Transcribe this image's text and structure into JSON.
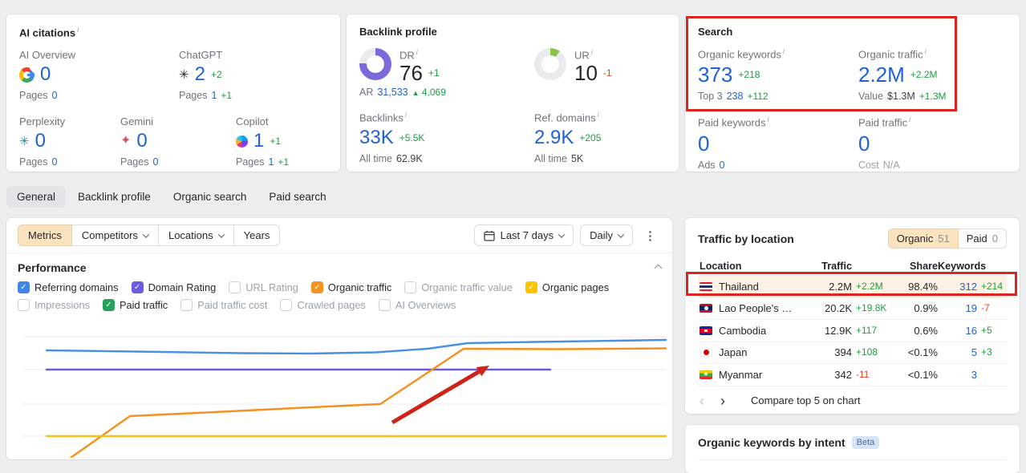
{
  "icons": {
    "info": "i",
    "check": "✓",
    "kebab": "⋮",
    "chevron_left": "‹",
    "chevron_right": "›",
    "up_triangle": "▲",
    "chatgpt_glyph": "✳",
    "perplexity_glyph": "✳",
    "gemini_glyph": "✦"
  },
  "ai_citations": {
    "title": "AI citations",
    "pages_label": "Pages",
    "items": [
      {
        "label": "AI Overview",
        "icon": "google-icon",
        "value": "0",
        "delta": "",
        "pages": "0",
        "pages_delta": ""
      },
      {
        "label": "ChatGPT",
        "icon": "chatgpt-icon",
        "value": "2",
        "delta": "+2",
        "pages": "1",
        "pages_delta": "+1"
      },
      {
        "label": "Perplexity",
        "icon": "perplexity-icon",
        "value": "0",
        "delta": "",
        "pages": "0",
        "pages_delta": ""
      },
      {
        "label": "Gemini",
        "icon": "gemini-icon",
        "value": "0",
        "delta": "",
        "pages": "0",
        "pages_delta": ""
      },
      {
        "label": "Copilot",
        "icon": "copilot-icon",
        "value": "1",
        "delta": "+1",
        "pages": "1",
        "pages_delta": "+1"
      }
    ]
  },
  "backlink_profile": {
    "title": "Backlink profile",
    "dr": {
      "label": "DR",
      "value": "76",
      "delta": "+1",
      "percent": 76,
      "color": "#7c68d8"
    },
    "ar": {
      "label": "AR",
      "value": "31,533",
      "delta": "4,069"
    },
    "ur": {
      "label": "UR",
      "value": "10",
      "delta": "-1",
      "delta_tone": "red",
      "percent": 10,
      "color": "#8bc34a"
    },
    "backlinks": {
      "label": "Backlinks",
      "value": "33K",
      "delta": "+5.5K",
      "alltime_label": "All time",
      "alltime": "62.9K"
    },
    "ref_domains": {
      "label": "Ref. domains",
      "value": "2.9K",
      "delta": "+205",
      "alltime_label": "All time",
      "alltime": "5K"
    }
  },
  "search": {
    "title": "Search",
    "organic_keywords": {
      "label": "Organic keywords",
      "value": "373",
      "delta": "+218",
      "sub_label": "Top 3",
      "sub_value": "238",
      "sub_delta": "+112"
    },
    "organic_traffic": {
      "label": "Organic traffic",
      "value": "2.2M",
      "delta": "+2.2M",
      "sub_label": "Value",
      "sub_value": "$1.3M",
      "sub_delta": "+1.3M"
    },
    "paid_keywords": {
      "label": "Paid keywords",
      "value": "0",
      "delta": "",
      "sub_label": "Ads",
      "sub_value": "0",
      "sub_delta": ""
    },
    "paid_traffic": {
      "label": "Paid traffic",
      "value": "0",
      "delta": "",
      "sub_label": "Cost",
      "sub_value": "N/A",
      "sub_delta": ""
    }
  },
  "tabs": [
    {
      "label": "General",
      "active": true
    },
    {
      "label": "Backlink profile",
      "active": false
    },
    {
      "label": "Organic search",
      "active": false
    },
    {
      "label": "Paid search",
      "active": false
    }
  ],
  "toolbar": {
    "segments": [
      "Metrics",
      "Competitors",
      "Locations",
      "Years"
    ],
    "date_range": "Last 7 days",
    "granularity": "Daily"
  },
  "performance": {
    "title": "Performance",
    "metrics": [
      {
        "label": "Referring domains",
        "checked": true,
        "color": "#4285e8"
      },
      {
        "label": "Domain Rating",
        "checked": true,
        "color": "#6c5ce0"
      },
      {
        "label": "URL Rating",
        "checked": false,
        "color": ""
      },
      {
        "label": "Organic traffic",
        "checked": true,
        "color": "#f7941f"
      },
      {
        "label": "Organic traffic value",
        "checked": false,
        "color": ""
      },
      {
        "label": "Organic pages",
        "checked": true,
        "color": "#fdc500"
      },
      {
        "label": "Impressions",
        "checked": false,
        "color": ""
      },
      {
        "label": "Paid traffic",
        "checked": true,
        "color": "#27a15a"
      },
      {
        "label": "Paid traffic cost",
        "checked": false,
        "color": ""
      },
      {
        "label": "Crawled pages",
        "checked": false,
        "color": ""
      },
      {
        "label": "AI Overviews",
        "checked": false,
        "color": ""
      }
    ]
  },
  "chart_data": {
    "type": "line",
    "title": "Performance",
    "note": "No axis tick labels visible in screenshot; series encoded as polyline points in an 830x173 viewport, y grows downward.",
    "grid": true,
    "gridlines_y": [
      22,
      63,
      106,
      146
    ],
    "series": [
      {
        "name": "Referring domains",
        "color": "#4a90e2",
        "points": [
          [
            50,
            39
          ],
          [
            160,
            40.5
          ],
          [
            290,
            42.5
          ],
          [
            380,
            43
          ],
          [
            460,
            41.5
          ],
          [
            525,
            37
          ],
          [
            575,
            30
          ],
          [
            660,
            28.5
          ],
          [
            760,
            27
          ],
          [
            822,
            26
          ]
        ]
      },
      {
        "name": "Domain Rating",
        "color": "#6c5cd3",
        "points": [
          [
            50,
            63
          ],
          [
            678,
            63
          ]
        ]
      },
      {
        "name": "Organic traffic",
        "color": "#f78f1e",
        "points": [
          [
            80,
            173
          ],
          [
            154,
            121
          ],
          [
            260,
            116
          ],
          [
            360,
            111
          ],
          [
            466,
            106
          ],
          [
            570,
            37
          ],
          [
            690,
            37.5
          ],
          [
            822,
            36.5
          ]
        ]
      },
      {
        "name": "Organic pages",
        "color": "#f7c116",
        "points": [
          [
            50,
            146
          ],
          [
            822,
            146
          ]
        ]
      }
    ],
    "annotation_arrow": {
      "from": [
        481,
        129
      ],
      "to": [
        602,
        58
      ],
      "color": "#cf2318"
    }
  },
  "traffic_by_location": {
    "title": "Traffic by location",
    "toggle": [
      {
        "label": "Organic",
        "count": "51",
        "active": true
      },
      {
        "label": "Paid",
        "count": "0",
        "active": false
      }
    ],
    "columns": {
      "location": "Location",
      "traffic": "Traffic",
      "share": "Share",
      "keywords": "Keywords"
    },
    "rows": [
      {
        "location": "Thailand",
        "flag": "th",
        "traffic": "2.2M",
        "traffic_delta": "+2.2M",
        "share": "98.4%",
        "keywords": "312",
        "keywords_delta": "+214",
        "highlighted": true
      },
      {
        "location": "Lao People's Democratic Reput",
        "flag": "la",
        "traffic": "20.2K",
        "traffic_delta": "+19.8K",
        "share": "0.9%",
        "keywords": "19",
        "keywords_delta": "-7",
        "keywords_delta_tone": "red",
        "highlighted": false
      },
      {
        "location": "Cambodia",
        "flag": "kh",
        "traffic": "12.9K",
        "traffic_delta": "+117",
        "share": "0.6%",
        "keywords": "16",
        "keywords_delta": "+5",
        "highlighted": false
      },
      {
        "location": "Japan",
        "flag": "jp",
        "traffic": "394",
        "traffic_delta": "+108",
        "share": "<0.1%",
        "keywords": "5",
        "keywords_delta": "+3",
        "highlighted": false
      },
      {
        "location": "Myanmar",
        "flag": "mm",
        "traffic": "342",
        "traffic_delta": "-11",
        "traffic_delta_tone": "red",
        "share": "<0.1%",
        "keywords": "3",
        "keywords_delta": "",
        "highlighted": false
      }
    ],
    "compare_label": "Compare top 5 on chart"
  },
  "organic_intent": {
    "title": "Organic keywords by intent",
    "badge": "Beta"
  }
}
